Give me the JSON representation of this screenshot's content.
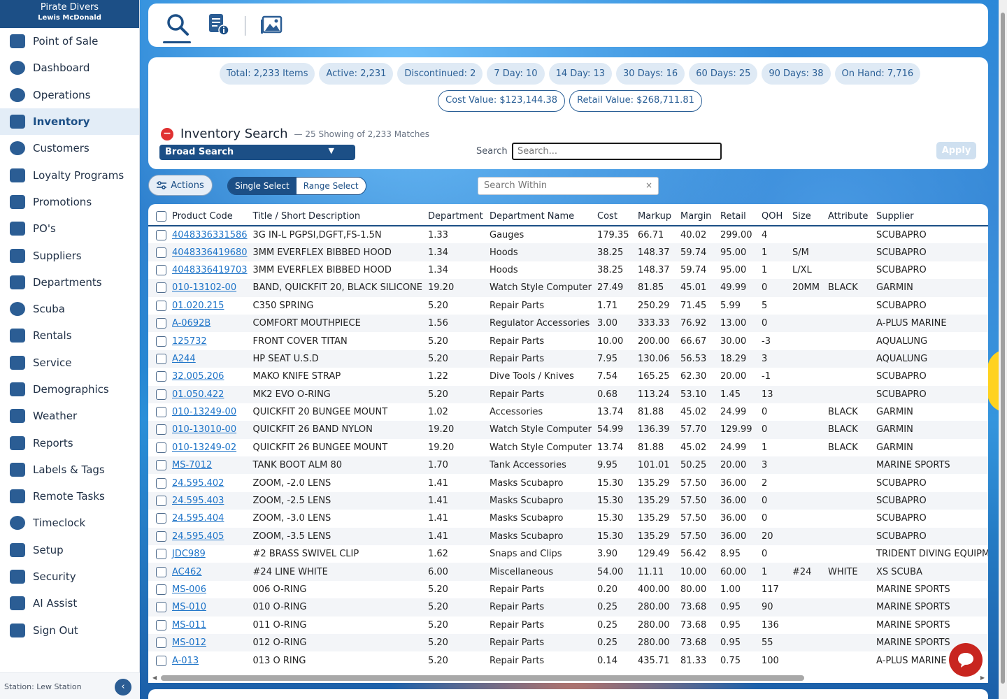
{
  "brand": {
    "name": "Pirate Divers",
    "user": "Lewis McDonald"
  },
  "sidebar": {
    "items": [
      {
        "label": "Point of Sale",
        "icon": "register-icon"
      },
      {
        "label": "Dashboard",
        "icon": "gauge-icon"
      },
      {
        "label": "Operations",
        "icon": "people-gear-icon"
      },
      {
        "label": "Inventory",
        "icon": "boxes-icon",
        "active": true
      },
      {
        "label": "Customers",
        "icon": "people-icon"
      },
      {
        "label": "Loyalty Programs",
        "icon": "stars-icon"
      },
      {
        "label": "Promotions",
        "icon": "megaphone-icon"
      },
      {
        "label": "PO's",
        "icon": "dollar-doc-icon"
      },
      {
        "label": "Suppliers",
        "icon": "truck-icon"
      },
      {
        "label": "Departments",
        "icon": "layers-icon"
      },
      {
        "label": "Scuba",
        "icon": "mask-icon"
      },
      {
        "label": "Rentals",
        "icon": "flag-icon"
      },
      {
        "label": "Service",
        "icon": "toolbox-icon"
      },
      {
        "label": "Demographics",
        "icon": "map-pin-icon"
      },
      {
        "label": "Weather",
        "icon": "weather-icon"
      },
      {
        "label": "Reports",
        "icon": "bar-chart-icon"
      },
      {
        "label": "Labels & Tags",
        "icon": "tags-icon"
      },
      {
        "label": "Remote Tasks",
        "icon": "tablet-icon"
      },
      {
        "label": "Timeclock",
        "icon": "clock-icon"
      },
      {
        "label": "Setup",
        "icon": "sliders-icon"
      },
      {
        "label": "Security",
        "icon": "user-lock-icon"
      },
      {
        "label": "AI Assist",
        "icon": "ai-icon"
      },
      {
        "label": "Sign Out",
        "icon": "sign-out-icon"
      }
    ],
    "station": "Station: Lew Station"
  },
  "summary": {
    "chips": [
      {
        "label": "Total: 2,233 Items"
      },
      {
        "label": "Active: 2,231"
      },
      {
        "label": "Discontinued: 2"
      },
      {
        "label": "7 Day: 10"
      },
      {
        "label": "14 Day: 13"
      },
      {
        "label": "30 Days: 16"
      },
      {
        "label": "60 Days: 25"
      },
      {
        "label": "90 Days: 38"
      },
      {
        "label": "On Hand: 7,716"
      },
      {
        "label": "Cost Value: $123,144.38",
        "outline": true
      },
      {
        "label": "Retail Value: $268,711.81",
        "outline": true
      }
    ]
  },
  "search": {
    "title": "Inventory Search",
    "subtitle": "— 25 Showing of 2,233 Matches",
    "mode": "Broad Search",
    "label": "Search",
    "placeholder": "Search...",
    "apply": "Apply"
  },
  "toolbar": {
    "actions": "Actions",
    "single_select": "Single Select",
    "range_select": "Range Select",
    "within_placeholder": "Search Within",
    "within_clear": "×"
  },
  "table": {
    "headers": [
      "Product Code",
      "Title / Short Description",
      "Department",
      "Department Name",
      "Cost",
      "Markup",
      "Margin",
      "Retail",
      "QOH",
      "Size",
      "Attribute",
      "Supplier"
    ],
    "rows": [
      [
        "4048336331586",
        "3G IN-L PGPSI,DGFT,FS-1.5N",
        "1.33",
        "Gauges",
        "179.35",
        "66.71",
        "40.02",
        "299.00",
        "4",
        "",
        "",
        "SCUBAPRO"
      ],
      [
        "4048336419680",
        "3MM EVERFLEX BIBBED HOOD",
        "1.34",
        "Hoods",
        "38.25",
        "148.37",
        "59.74",
        "95.00",
        "1",
        "S/M",
        "",
        "SCUBAPRO"
      ],
      [
        "4048336419703",
        "3MM EVERFLEX BIBBED HOOD",
        "1.34",
        "Hoods",
        "38.25",
        "148.37",
        "59.74",
        "95.00",
        "1",
        "L/XL",
        "",
        "SCUBAPRO"
      ],
      [
        "010-13102-00",
        "BAND, QUICKFIT 20, BLACK SILICONE",
        "19.20",
        "Watch Style Computer",
        "27.49",
        "81.85",
        "45.01",
        "49.99",
        "0",
        "20MM",
        "BLACK",
        "GARMIN"
      ],
      [
        "01.020.215",
        "C350 SPRING",
        "5.20",
        "Repair Parts",
        "1.71",
        "250.29",
        "71.45",
        "5.99",
        "5",
        "",
        "",
        "SCUBAPRO"
      ],
      [
        "A-0692B",
        "COMFORT MOUTHPIECE",
        "1.56",
        "Regulator Accessories",
        "3.00",
        "333.33",
        "76.92",
        "13.00",
        "0",
        "",
        "",
        "A-PLUS MARINE"
      ],
      [
        "125732",
        "FRONT COVER TITAN",
        "5.20",
        "Repair Parts",
        "10.00",
        "200.00",
        "66.67",
        "30.00",
        "-3",
        "",
        "",
        "AQUALUNG"
      ],
      [
        "A244",
        "HP SEAT U.S.D",
        "5.20",
        "Repair Parts",
        "7.95",
        "130.06",
        "56.53",
        "18.29",
        "3",
        "",
        "",
        "AQUALUNG"
      ],
      [
        "32.005.206",
        "MAKO KNIFE STRAP",
        "1.22",
        "Dive Tools / Knives",
        "7.54",
        "165.25",
        "62.30",
        "20.00",
        "-1",
        "",
        "",
        "SCUBAPRO"
      ],
      [
        "01.050.422",
        "MK2 EVO O-RING",
        "5.20",
        "Repair Parts",
        "0.68",
        "113.24",
        "53.10",
        "1.45",
        "13",
        "",
        "",
        "SCUBAPRO"
      ],
      [
        "010-13249-00",
        "QUICKFIT 20 BUNGEE MOUNT",
        "1.02",
        "Accessories",
        "13.74",
        "81.88",
        "45.02",
        "24.99",
        "0",
        "",
        "BLACK",
        "GARMIN"
      ],
      [
        "010-13010-00",
        "QUICKFIT 26 BAND NYLON",
        "19.20",
        "Watch Style Computer",
        "54.99",
        "136.39",
        "57.70",
        "129.99",
        "0",
        "",
        "BLACK",
        "GARMIN"
      ],
      [
        "010-13249-02",
        "QUICKFIT 26 BUNGEE MOUNT",
        "19.20",
        "Watch Style Computer",
        "13.74",
        "81.88",
        "45.02",
        "24.99",
        "1",
        "",
        "BLACK",
        "GARMIN"
      ],
      [
        "MS-7012",
        "TANK BOOT ALM 80",
        "1.70",
        "Tank Accessories",
        "9.95",
        "101.01",
        "50.25",
        "20.00",
        "3",
        "",
        "",
        "MARINE SPORTS"
      ],
      [
        "24.595.402",
        "ZOOM, -2.0 LENS",
        "1.41",
        "Masks Scubapro",
        "15.30",
        "135.29",
        "57.50",
        "36.00",
        "2",
        "",
        "",
        "SCUBAPRO"
      ],
      [
        "24.595.403",
        "ZOOM, -2.5 LENS",
        "1.41",
        "Masks Scubapro",
        "15.30",
        "135.29",
        "57.50",
        "36.00",
        "0",
        "",
        "",
        "SCUBAPRO"
      ],
      [
        "24.595.404",
        "ZOOM, -3.0 LENS",
        "1.41",
        "Masks Scubapro",
        "15.30",
        "135.29",
        "57.50",
        "36.00",
        "0",
        "",
        "",
        "SCUBAPRO"
      ],
      [
        "24.595.405",
        "ZOOM, -3.5 LENS",
        "1.41",
        "Masks Scubapro",
        "15.30",
        "135.29",
        "57.50",
        "36.00",
        "20",
        "",
        "",
        "SCUBAPRO"
      ],
      [
        "JDC989",
        "#2 BRASS SWIVEL CLIP",
        "1.62",
        "Snaps and Clips",
        "3.90",
        "129.49",
        "56.42",
        "8.95",
        "0",
        "",
        "",
        "TRIDENT DIVING EQUIPMENT"
      ],
      [
        "AC462",
        "#24 LINE WHITE",
        "6.00",
        "Miscellaneous",
        "54.00",
        "11.11",
        "10.00",
        "60.00",
        "1",
        "#24",
        "WHITE",
        "XS SCUBA"
      ],
      [
        "MS-006",
        "006 O-RING",
        "5.20",
        "Repair Parts",
        "0.20",
        "400.00",
        "80.00",
        "1.00",
        "117",
        "",
        "",
        "MARINE SPORTS"
      ],
      [
        "MS-010",
        "010 O-RING",
        "5.20",
        "Repair Parts",
        "0.25",
        "280.00",
        "73.68",
        "0.95",
        "90",
        "",
        "",
        "MARINE SPORTS"
      ],
      [
        "MS-011",
        "011 O-RING",
        "5.20",
        "Repair Parts",
        "0.25",
        "280.00",
        "73.68",
        "0.95",
        "136",
        "",
        "",
        "MARINE SPORTS"
      ],
      [
        "MS-012",
        "012 O-RING",
        "5.20",
        "Repair Parts",
        "0.25",
        "280.00",
        "73.68",
        "0.95",
        "55",
        "",
        "",
        "MARINE SPORTS"
      ],
      [
        "A-013",
        "013 O RING",
        "5.20",
        "Repair Parts",
        "0.14",
        "435.71",
        "81.33",
        "0.75",
        "100",
        "",
        "",
        "A-PLUS MARINE"
      ]
    ]
  },
  "colors": {
    "primary": "#1c4f86",
    "link": "#1e74c8",
    "chip_bg": "#dfeaf5",
    "danger": "#e03131"
  }
}
